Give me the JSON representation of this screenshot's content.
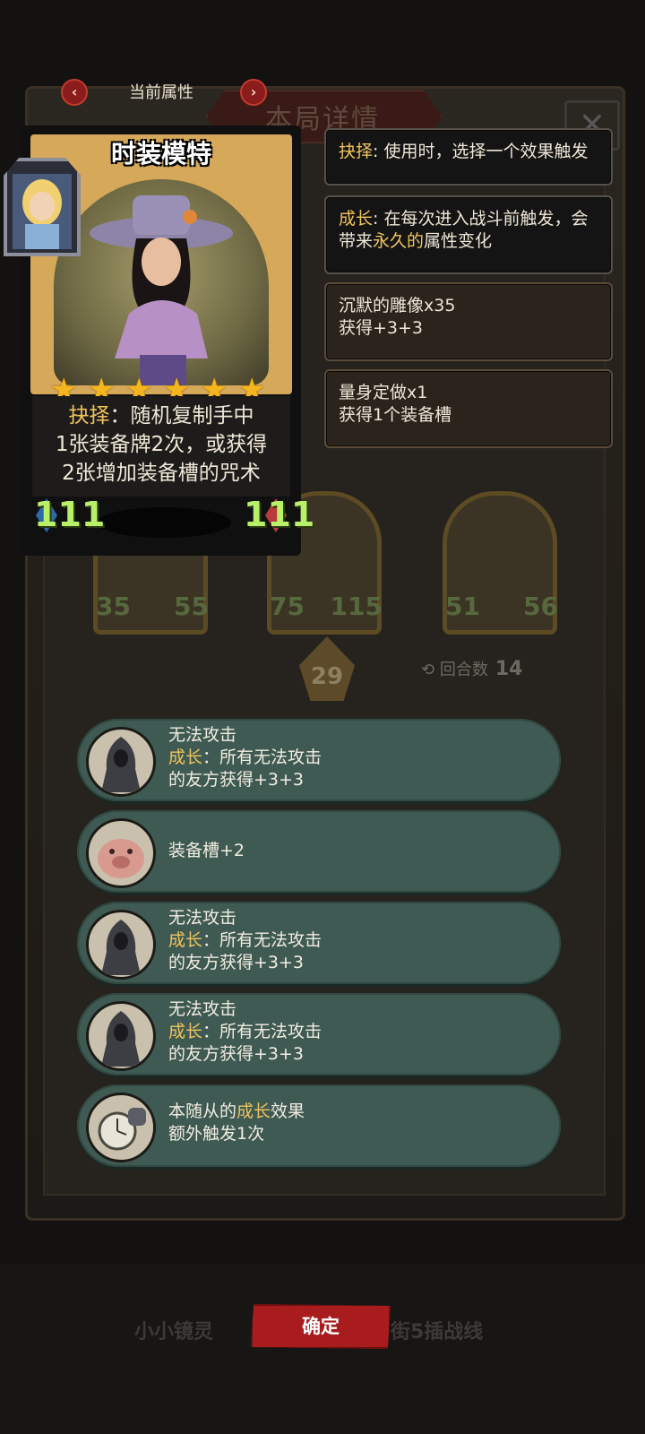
{
  "background": {
    "title": "本局详情",
    "close_glyph": "✕",
    "cards": [
      {
        "atk": "35",
        "hp": "55"
      },
      {
        "atk": "75",
        "hp": "115"
      },
      {
        "atk": "51",
        "hp": "56"
      }
    ],
    "level": "29",
    "round_label": "回合数",
    "round_value": "14",
    "bottom_tabs": [
      "小小镜灵",
      "街5插战线"
    ]
  },
  "attribute_selector": {
    "label": "当前属性",
    "prev_glyph": "‹",
    "next_glyph": "›"
  },
  "hero_card": {
    "name": "时装模特",
    "stars": 6,
    "desc_keyword": "抉择",
    "desc_line1_rest": "：随机复制手中",
    "desc_line2": "1张装备牌2次，或获得",
    "desc_line3": "2张增加装备槽的咒术",
    "attack": "111",
    "health": "111"
  },
  "tooltips": [
    {
      "keyword": "抉择",
      "text": ": 使用时，选择一个效果触发"
    },
    {
      "keyword": "成长",
      "text_a": ": 在每次进入战斗前触发，会带来",
      "keyword2": "永久的",
      "text_b": "属性变化"
    },
    {
      "line1": "沉默的雕像x35",
      "line2": "获得+3+3"
    },
    {
      "line1": "量身定做x1",
      "line2": "获得1个装备槽"
    }
  ],
  "effects": [
    {
      "icon": "hooded-figure-icon",
      "title": "无法攻击",
      "keyword": "成长",
      "line2_rest": "：所有无法攻击",
      "line3": "的友方获得+3+3"
    },
    {
      "icon": "pig-icon",
      "title": "装备槽+2"
    },
    {
      "icon": "hooded-figure-icon",
      "title": "无法攻击",
      "keyword": "成长",
      "line2_rest": "：所有无法攻击",
      "line3": "的友方获得+3+3"
    },
    {
      "icon": "hooded-figure-icon",
      "title": "无法攻击",
      "keyword": "成长",
      "line2_rest": "：所有无法攻击",
      "line3": "的友方获得+3+3"
    },
    {
      "icon": "stopwatch-hand-icon",
      "line1_pre": "本随从的",
      "keyword": "成长",
      "line1_post": "效果",
      "line2": "额外触发1次"
    }
  ],
  "confirm_label": "确定",
  "colors": {
    "keyword": "#f0c45c",
    "effect_row": "#3f5a52",
    "confirm": "#a81c1e",
    "hero_stat": "#b8f06a"
  }
}
